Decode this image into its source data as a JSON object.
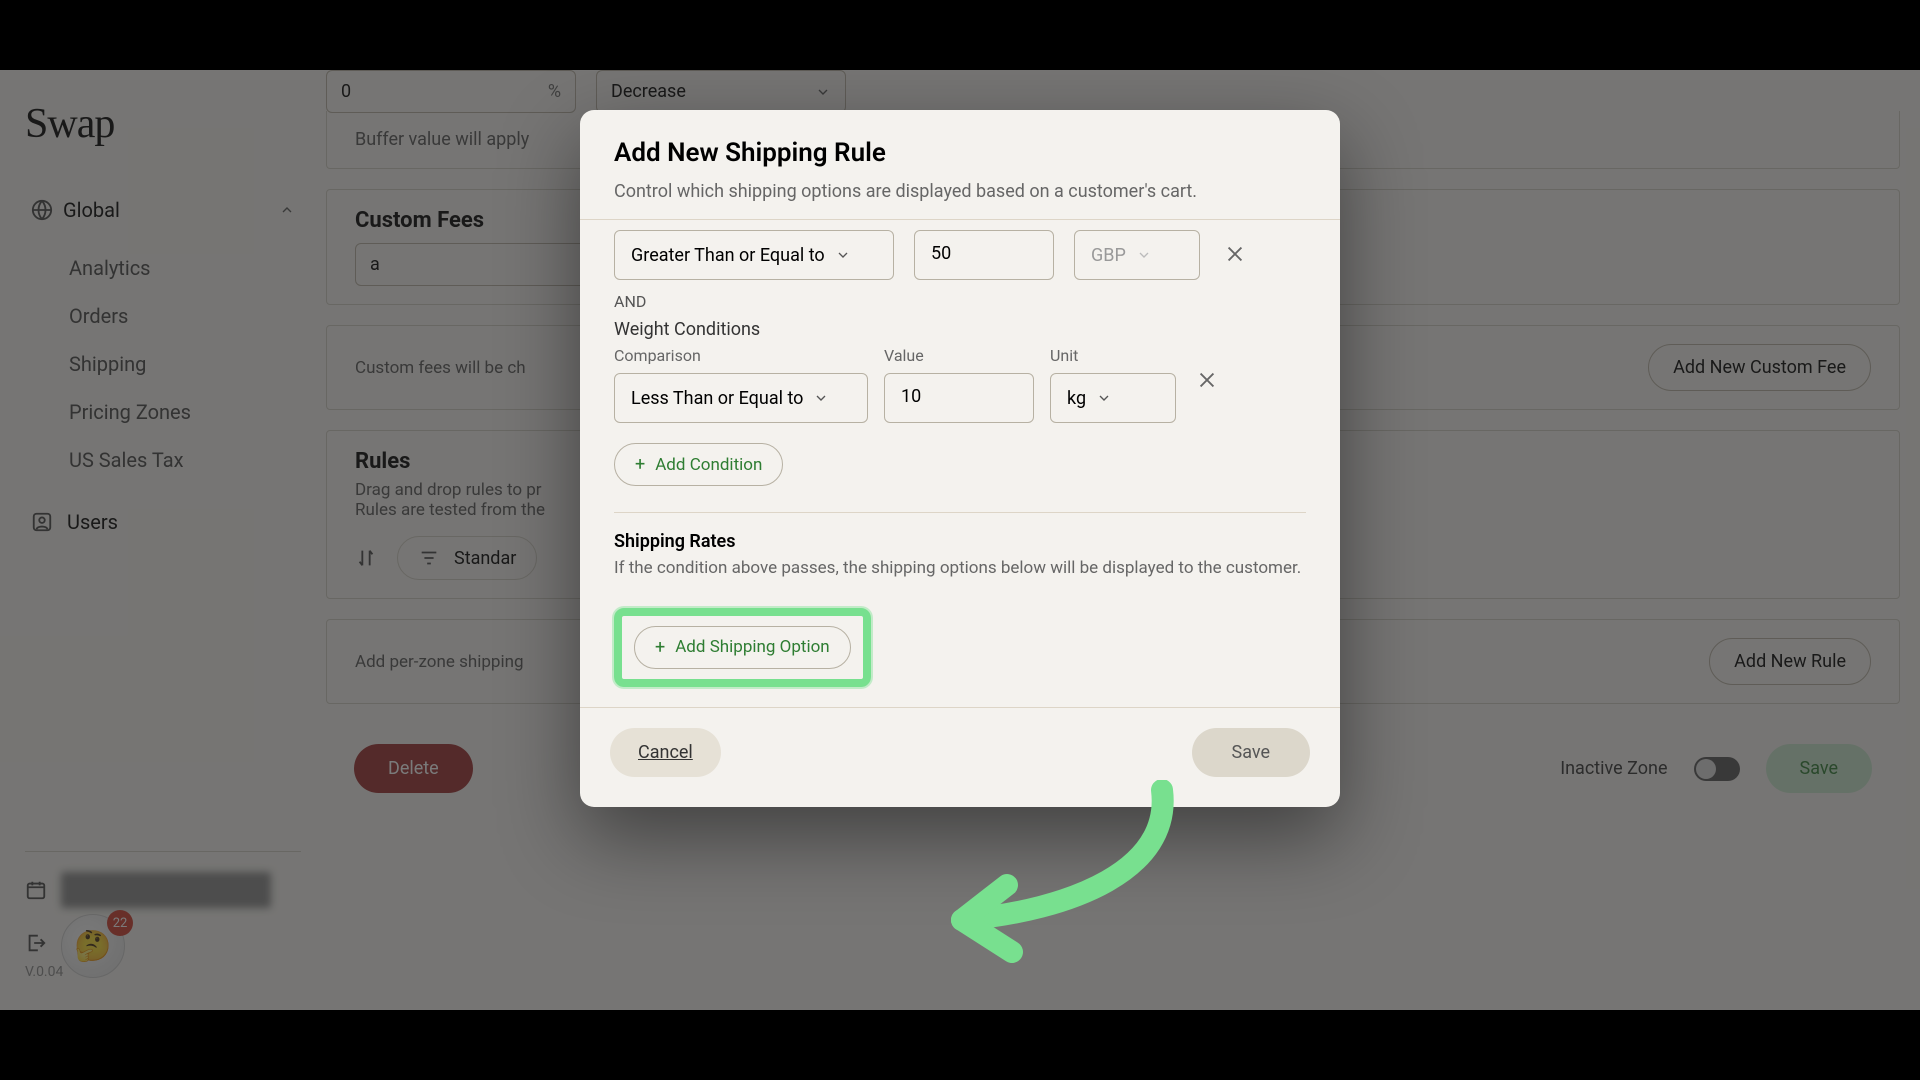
{
  "brand": "Swap",
  "sidebar": {
    "global_label": "Global",
    "items": [
      {
        "label": "Analytics"
      },
      {
        "label": "Orders"
      },
      {
        "label": "Shipping"
      },
      {
        "label": "Pricing Zones"
      },
      {
        "label": "US Sales Tax"
      }
    ],
    "users_label": "Users",
    "badge_count": "22",
    "version": "V.0.04"
  },
  "main": {
    "buffer": {
      "value": "0",
      "suffix": "%",
      "mode": "Decrease",
      "note_prefix": "Buffer value will apply"
    },
    "custom_fees": {
      "title": "Custom Fees",
      "input_value": "a",
      "charge_note_prefix": "Custom fees will be ch",
      "add_button": "Add New Custom Fee"
    },
    "rules": {
      "title": "Rules",
      "sub1_prefix": "Drag and drop rules to pr",
      "sub2_prefix": "Rules are tested from the",
      "chip_label_prefix": "Standar",
      "add_row_prefix": "Add per-zone shipping",
      "add_button": "Add New Rule"
    },
    "footer": {
      "delete": "Delete",
      "inactive": "Inactive Zone",
      "save": "Save"
    }
  },
  "modal": {
    "title": "Add New Shipping Rule",
    "description": "Control which shipping options are displayed based on a customer's cart.",
    "price_condition": {
      "comparison": "Greater Than or Equal to",
      "value": "50",
      "currency": "GBP"
    },
    "connector": "AND",
    "weight_section_label": "Weight Conditions",
    "labels": {
      "comparison": "Comparison",
      "value": "Value",
      "unit": "Unit"
    },
    "weight_condition": {
      "comparison": "Less Than or Equal to",
      "value": "10",
      "unit": "kg"
    },
    "add_condition": "Add Condition",
    "rates_title": "Shipping Rates",
    "rates_sub": "If the condition above passes, the shipping options below will be displayed to the customer.",
    "add_option": "Add Shipping Option",
    "cancel": "Cancel",
    "save": "Save"
  }
}
